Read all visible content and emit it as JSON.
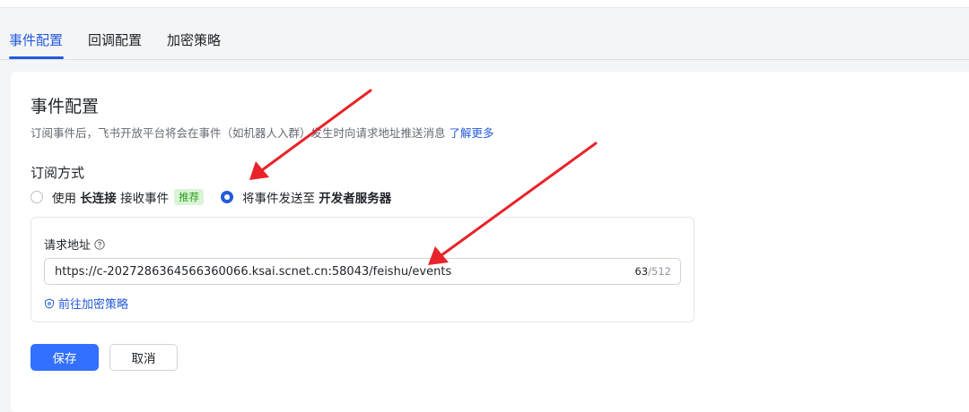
{
  "tabs": [
    {
      "label": "事件配置",
      "active": true
    },
    {
      "label": "回调配置",
      "active": false
    },
    {
      "label": "加密策略",
      "active": false
    }
  ],
  "section": {
    "title": "事件配置",
    "description": "订阅事件后，飞书开放平台将会在事件（如机器人入群）发生时向请求地址推送消息",
    "learn_more": "了解更多"
  },
  "subscription": {
    "label": "订阅方式",
    "option1": {
      "prefix": "使用 ",
      "bold": "长连接",
      "suffix": " 接收事件",
      "badge": "推荐",
      "selected": false
    },
    "option2": {
      "prefix": "将事件发送至 ",
      "bold": "开发者服务器",
      "selected": true
    }
  },
  "request_url": {
    "label": "请求地址",
    "value": "https://c-2027286364566360066.ksai.scnet.cn:58043/feishu/events",
    "count_current": "63",
    "count_max": "/512",
    "encrypt_link": "前往加密策略"
  },
  "buttons": {
    "save": "保存",
    "cancel": "取消"
  },
  "colors": {
    "accent": "#3370ff",
    "link": "#245bdb",
    "annotation_arrow": "#e8232a",
    "badge_bg": "#d9f5d6",
    "badge_text": "#2ea121"
  },
  "icons": {
    "help": "question-circle-icon",
    "encrypt": "shield-icon"
  }
}
